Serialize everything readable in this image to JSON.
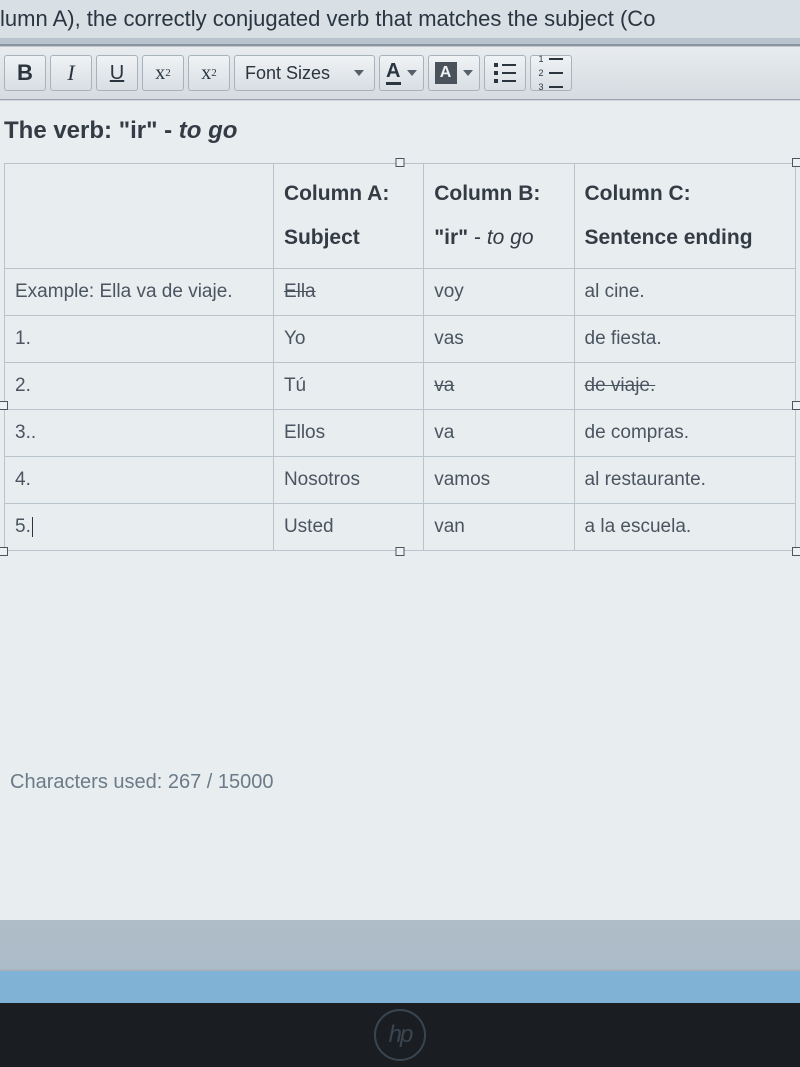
{
  "instruction_text": "lumn A), the correctly conjugated verb that matches the subject (Co",
  "toolbar": {
    "bold": "B",
    "italic": "I",
    "underline": "U",
    "superscript_base": "x",
    "superscript_exp": "2",
    "subscript_base": "x",
    "subscript_exp": "2",
    "font_sizes": "Font Sizes",
    "text_color_label": "A",
    "bg_color_label": "A"
  },
  "heading": {
    "prefix": "The verb: \"ir\" - ",
    "italic": "to go"
  },
  "table": {
    "headers": {
      "colA_top": "Column A:",
      "colA_bot": "Subject",
      "colB_top": "Column B:",
      "colB_bot_quoted": "\"ir\"",
      "colB_bot_dash": " - ",
      "colB_bot_italic": "to go",
      "colC_top": "Column C:",
      "colC_bot": "Sentence ending"
    },
    "rows": [
      {
        "label": "Example: Ella va de viaje.",
        "colA": "Ella",
        "colA_strike": true,
        "colB": "voy",
        "colB_strike": false,
        "colC": "al cine.",
        "colC_strike": false
      },
      {
        "label": "1.",
        "colA": "Yo",
        "colA_strike": false,
        "colB": "vas",
        "colB_strike": false,
        "colC": "de fiesta.",
        "colC_strike": false
      },
      {
        "label": "2.",
        "colA": "Tú",
        "colA_strike": false,
        "colB": "va",
        "colB_strike": true,
        "colC": "de viaje.",
        "colC_strike": true
      },
      {
        "label": "3..",
        "colA": "Ellos",
        "colA_strike": false,
        "colB": "va",
        "colB_strike": false,
        "colC": "de compras.",
        "colC_strike": false
      },
      {
        "label": "4.",
        "colA": "Nosotros",
        "colA_strike": false,
        "colB": "vamos",
        "colB_strike": false,
        "colC": "al restaurante.",
        "colC_strike": false
      },
      {
        "label": "5.",
        "colA": "Usted",
        "colA_strike": false,
        "colB": "van",
        "colB_strike": false,
        "colC": "a la escuela.",
        "colC_strike": false
      }
    ]
  },
  "char_count": "Characters used: 267 / 15000",
  "hp": "hp"
}
